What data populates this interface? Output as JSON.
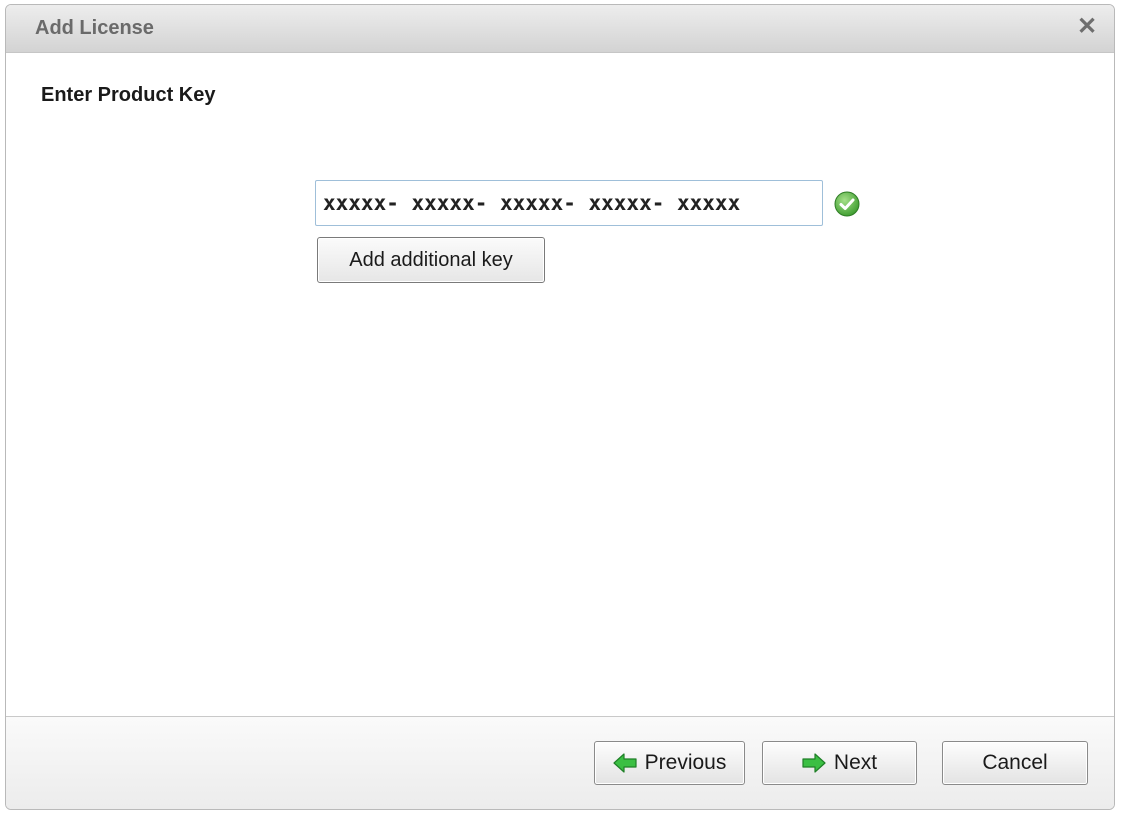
{
  "window": {
    "title": "Add License",
    "close_symbol": "✕"
  },
  "content": {
    "heading": "Enter Product Key",
    "product_key_value": "xxxxx- xxxxx- xxxxx- xxxxx- xxxxx",
    "valid_icon": "check-circle-icon",
    "add_key_label": "Add additional key"
  },
  "footer": {
    "previous_label": "Previous",
    "next_label": "Next",
    "cancel_label": "Cancel",
    "arrow_icon_color": "#2fae3a"
  }
}
